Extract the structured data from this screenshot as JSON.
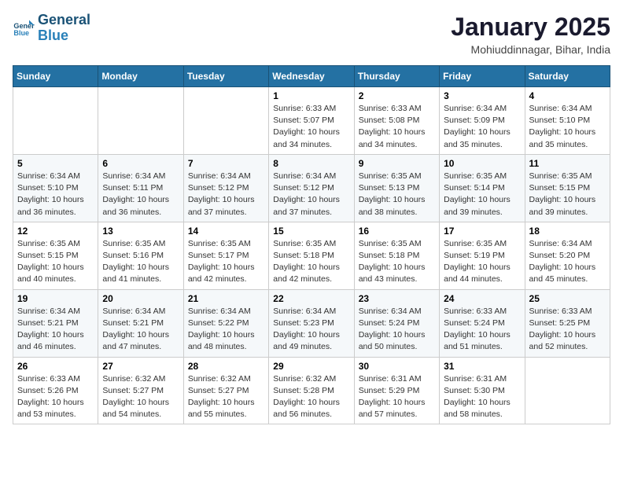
{
  "header": {
    "logo_line1": "General",
    "logo_line2": "Blue",
    "title": "January 2025",
    "subtitle": "Mohiuddinnagar, Bihar, India"
  },
  "days_of_week": [
    "Sunday",
    "Monday",
    "Tuesday",
    "Wednesday",
    "Thursday",
    "Friday",
    "Saturday"
  ],
  "weeks": [
    [
      {
        "day": "",
        "info": ""
      },
      {
        "day": "",
        "info": ""
      },
      {
        "day": "",
        "info": ""
      },
      {
        "day": "1",
        "info": "Sunrise: 6:33 AM\nSunset: 5:07 PM\nDaylight: 10 hours\nand 34 minutes."
      },
      {
        "day": "2",
        "info": "Sunrise: 6:33 AM\nSunset: 5:08 PM\nDaylight: 10 hours\nand 34 minutes."
      },
      {
        "day": "3",
        "info": "Sunrise: 6:34 AM\nSunset: 5:09 PM\nDaylight: 10 hours\nand 35 minutes."
      },
      {
        "day": "4",
        "info": "Sunrise: 6:34 AM\nSunset: 5:10 PM\nDaylight: 10 hours\nand 35 minutes."
      }
    ],
    [
      {
        "day": "5",
        "info": "Sunrise: 6:34 AM\nSunset: 5:10 PM\nDaylight: 10 hours\nand 36 minutes."
      },
      {
        "day": "6",
        "info": "Sunrise: 6:34 AM\nSunset: 5:11 PM\nDaylight: 10 hours\nand 36 minutes."
      },
      {
        "day": "7",
        "info": "Sunrise: 6:34 AM\nSunset: 5:12 PM\nDaylight: 10 hours\nand 37 minutes."
      },
      {
        "day": "8",
        "info": "Sunrise: 6:34 AM\nSunset: 5:12 PM\nDaylight: 10 hours\nand 37 minutes."
      },
      {
        "day": "9",
        "info": "Sunrise: 6:35 AM\nSunset: 5:13 PM\nDaylight: 10 hours\nand 38 minutes."
      },
      {
        "day": "10",
        "info": "Sunrise: 6:35 AM\nSunset: 5:14 PM\nDaylight: 10 hours\nand 39 minutes."
      },
      {
        "day": "11",
        "info": "Sunrise: 6:35 AM\nSunset: 5:15 PM\nDaylight: 10 hours\nand 39 minutes."
      }
    ],
    [
      {
        "day": "12",
        "info": "Sunrise: 6:35 AM\nSunset: 5:15 PM\nDaylight: 10 hours\nand 40 minutes."
      },
      {
        "day": "13",
        "info": "Sunrise: 6:35 AM\nSunset: 5:16 PM\nDaylight: 10 hours\nand 41 minutes."
      },
      {
        "day": "14",
        "info": "Sunrise: 6:35 AM\nSunset: 5:17 PM\nDaylight: 10 hours\nand 42 minutes."
      },
      {
        "day": "15",
        "info": "Sunrise: 6:35 AM\nSunset: 5:18 PM\nDaylight: 10 hours\nand 42 minutes."
      },
      {
        "day": "16",
        "info": "Sunrise: 6:35 AM\nSunset: 5:18 PM\nDaylight: 10 hours\nand 43 minutes."
      },
      {
        "day": "17",
        "info": "Sunrise: 6:35 AM\nSunset: 5:19 PM\nDaylight: 10 hours\nand 44 minutes."
      },
      {
        "day": "18",
        "info": "Sunrise: 6:34 AM\nSunset: 5:20 PM\nDaylight: 10 hours\nand 45 minutes."
      }
    ],
    [
      {
        "day": "19",
        "info": "Sunrise: 6:34 AM\nSunset: 5:21 PM\nDaylight: 10 hours\nand 46 minutes."
      },
      {
        "day": "20",
        "info": "Sunrise: 6:34 AM\nSunset: 5:21 PM\nDaylight: 10 hours\nand 47 minutes."
      },
      {
        "day": "21",
        "info": "Sunrise: 6:34 AM\nSunset: 5:22 PM\nDaylight: 10 hours\nand 48 minutes."
      },
      {
        "day": "22",
        "info": "Sunrise: 6:34 AM\nSunset: 5:23 PM\nDaylight: 10 hours\nand 49 minutes."
      },
      {
        "day": "23",
        "info": "Sunrise: 6:34 AM\nSunset: 5:24 PM\nDaylight: 10 hours\nand 50 minutes."
      },
      {
        "day": "24",
        "info": "Sunrise: 6:33 AM\nSunset: 5:24 PM\nDaylight: 10 hours\nand 51 minutes."
      },
      {
        "day": "25",
        "info": "Sunrise: 6:33 AM\nSunset: 5:25 PM\nDaylight: 10 hours\nand 52 minutes."
      }
    ],
    [
      {
        "day": "26",
        "info": "Sunrise: 6:33 AM\nSunset: 5:26 PM\nDaylight: 10 hours\nand 53 minutes."
      },
      {
        "day": "27",
        "info": "Sunrise: 6:32 AM\nSunset: 5:27 PM\nDaylight: 10 hours\nand 54 minutes."
      },
      {
        "day": "28",
        "info": "Sunrise: 6:32 AM\nSunset: 5:27 PM\nDaylight: 10 hours\nand 55 minutes."
      },
      {
        "day": "29",
        "info": "Sunrise: 6:32 AM\nSunset: 5:28 PM\nDaylight: 10 hours\nand 56 minutes."
      },
      {
        "day": "30",
        "info": "Sunrise: 6:31 AM\nSunset: 5:29 PM\nDaylight: 10 hours\nand 57 minutes."
      },
      {
        "day": "31",
        "info": "Sunrise: 6:31 AM\nSunset: 5:30 PM\nDaylight: 10 hours\nand 58 minutes."
      },
      {
        "day": "",
        "info": ""
      }
    ]
  ]
}
